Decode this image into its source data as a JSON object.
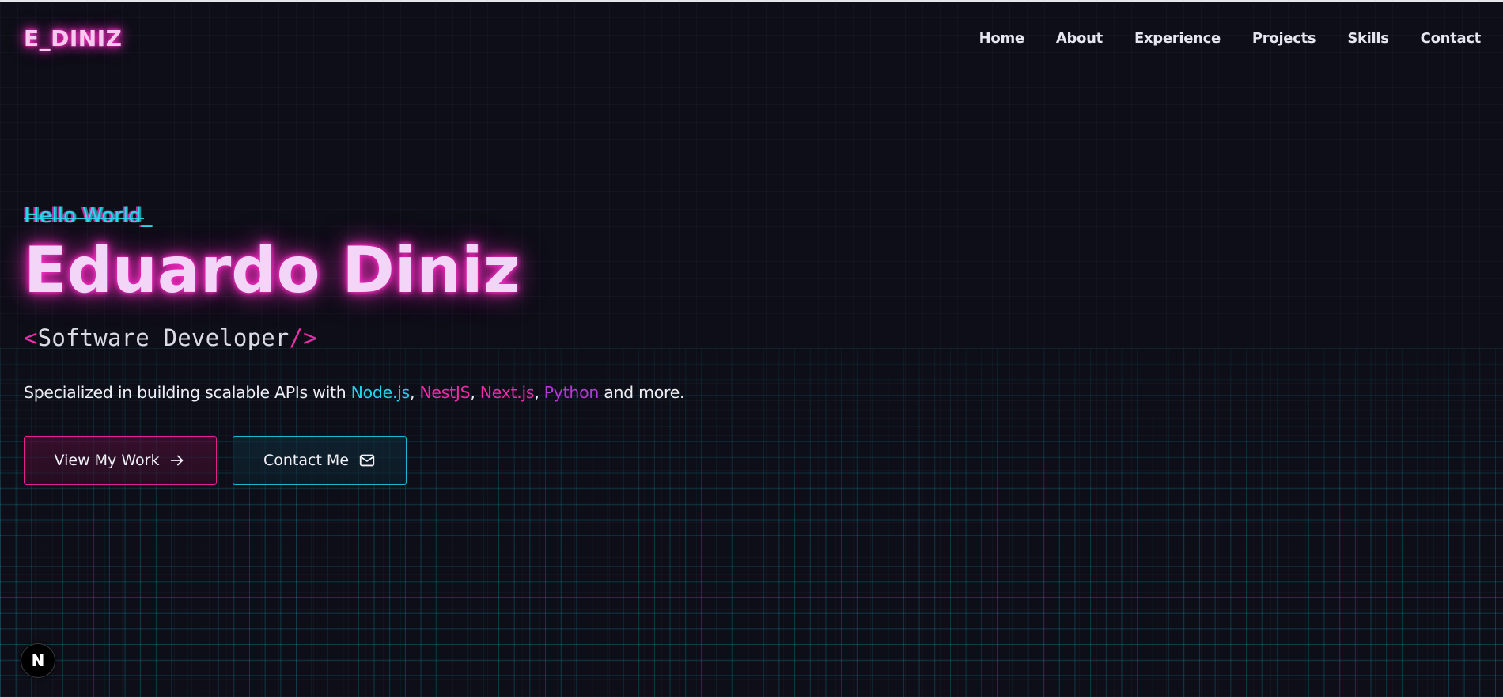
{
  "header": {
    "logo": "E_DINIZ",
    "nav": [
      {
        "label": "Home"
      },
      {
        "label": "About"
      },
      {
        "label": "Experience"
      },
      {
        "label": "Projects"
      },
      {
        "label": "Skills"
      },
      {
        "label": "Contact"
      }
    ]
  },
  "hero": {
    "greeting": "Hello World_",
    "name": "Eduardo Diniz",
    "role": {
      "open": "<",
      "title": "Software Developer",
      "close": "/>"
    },
    "description": {
      "prefix": "Specialized in building scalable APIs with ",
      "tech": [
        "Node.js",
        "NestJS",
        "Next.js",
        "Python"
      ],
      "sep1": ", ",
      "sep2": ", ",
      "sep3": ", ",
      "suffix": " and more."
    },
    "buttons": {
      "work_label": "View My Work",
      "contact_label": "Contact Me"
    }
  },
  "badge": {
    "label": "N"
  },
  "colors": {
    "background": "#0d0e17",
    "neon_pink": "#ff2dc8",
    "neon_cyan": "#22d3ee",
    "magenta": "#f02aa8",
    "purple": "#b33ad6"
  },
  "icons": {
    "work_button": "arrow-right-icon",
    "contact_button": "mail-icon",
    "badge": "nextjs-logo-icon"
  }
}
